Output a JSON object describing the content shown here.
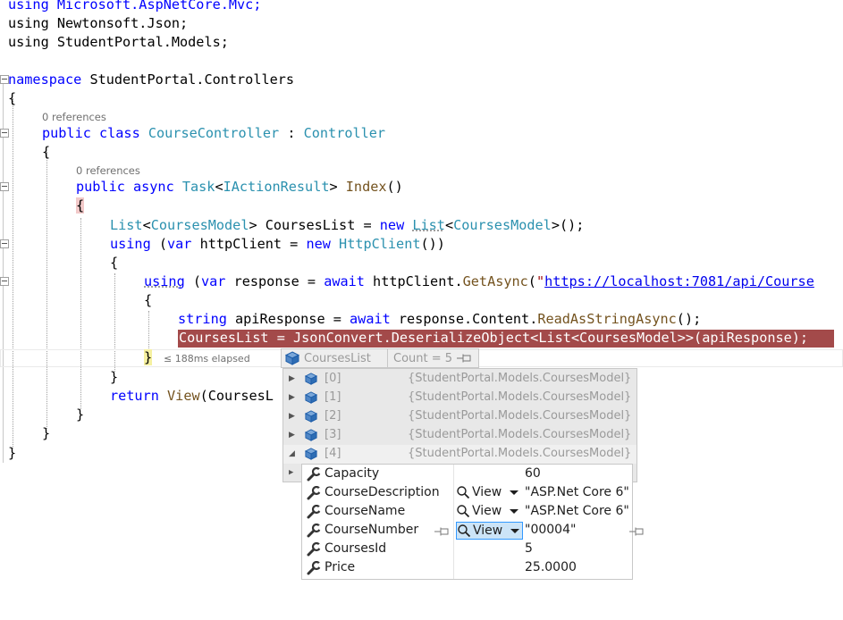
{
  "code": {
    "line1": "using Microsoft.AspNetCore.Mvc;",
    "line2": "using Newtonsoft.Json;",
    "line3": "using StudentPortal.Models;",
    "ns_kw": "namespace",
    "ns_name": " StudentPortal.Controllers",
    "brace_open": "{",
    "brace_close": "}",
    "codelens_class": "0 references",
    "class_kw": "public class ",
    "class_name": "CourseController",
    "class_sep": " : ",
    "class_base": "Controller",
    "codelens_method": "0 references",
    "method_kw": "public async ",
    "method_task": "Task",
    "method_lt": "<",
    "method_iface": "IActionResult",
    "method_gt": "> ",
    "method_name": "Index",
    "method_paren": "()",
    "l_list_type": "List",
    "l_list_lt": "<",
    "l_list_model": "CoursesModel",
    "l_list_rest1": "> CoursesList = ",
    "l_list_new": "new ",
    "l_list_type2": "List",
    "l_list_lt2": "<",
    "l_list_model2": "CoursesModel",
    "l_list_end": ">();",
    "l_using1_kw": "using",
    "l_using1_a": " (",
    "l_using1_var": "var",
    "l_using1_b": " httpClient = ",
    "l_using1_new": "new ",
    "l_using1_type": "HttpClient",
    "l_using1_end": "())",
    "l_using2_kw": "using",
    "l_using2_a": " (",
    "l_using2_var": "var",
    "l_using2_b": " response = ",
    "l_using2_await": "await",
    "l_using2_c": " httpClient.",
    "l_using2_fn": "GetAsync",
    "l_using2_d": "(",
    "l_using2_q": "\"",
    "l_using2_url": "https://localhost:7081/api/Course",
    "l_string_kw": "string",
    "l_string_a": " apiResponse = ",
    "l_string_await": "await",
    "l_string_b": " response.Content.",
    "l_string_fn": "ReadAsStringAsync",
    "l_string_end": "();",
    "l_deser": "CoursesList = JsonConvert.DeserializeObject<List<CoursesModel>>(apiResponse);",
    "elapsed": "≤ 188ms elapsed",
    "l_return_kw": "return",
    "l_return_a": " ",
    "l_return_fn": "View",
    "l_return_b": "(CoursesL"
  },
  "datatip": {
    "var_name": "CoursesList",
    "count": "Count = 5",
    "items": [
      {
        "name": "[0]",
        "value": "{StudentPortal.Models.CoursesModel}"
      },
      {
        "name": "[1]",
        "value": "{StudentPortal.Models.CoursesModel}"
      },
      {
        "name": "[2]",
        "value": "{StudentPortal.Models.CoursesModel}"
      },
      {
        "name": "[3]",
        "value": "{StudentPortal.Models.CoursesModel}"
      },
      {
        "name": "[4]",
        "value": "{StudentPortal.Models.CoursesModel}"
      }
    ],
    "view_label": "View",
    "properties": [
      {
        "name": "Capacity",
        "value": "60"
      },
      {
        "name": "CourseDescription",
        "value": "\"ASP.Net Core 6\""
      },
      {
        "name": "CourseName",
        "value": "\"ASP.Net Core 6\""
      },
      {
        "name": "CourseNumber",
        "value": "\"00004\""
      },
      {
        "name": "CoursesId",
        "value": "5"
      },
      {
        "name": "Price",
        "value": "25.0000"
      }
    ]
  },
  "colors": {
    "keyword": "#0000ff",
    "type": "#2b91af",
    "method": "#74531f",
    "string": "#a31515",
    "current_statement": "#a34a4a"
  }
}
